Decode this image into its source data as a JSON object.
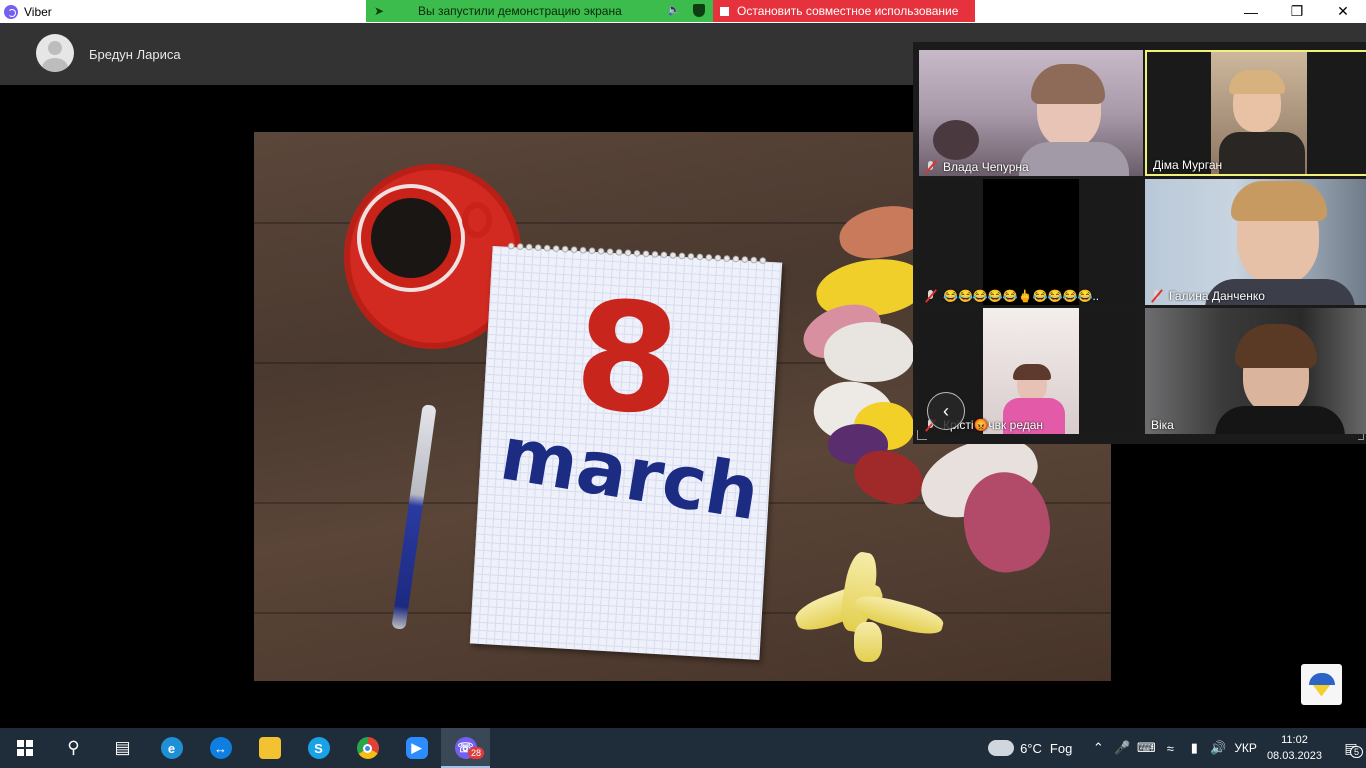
{
  "window": {
    "title": "Viber"
  },
  "share_banner": {
    "status_text": "Вы запустили демонстрацию экрана",
    "stop_text": "Остановить совместное использование",
    "colors": {
      "green": "#3cbc4c",
      "red": "#e5323c"
    }
  },
  "caller": {
    "name": "Бредун Лариса"
  },
  "shared_screen": {
    "big_number": "8",
    "word": "march"
  },
  "participants": [
    {
      "name": "Влада Чепурна",
      "muted": true
    },
    {
      "name": "Діма Мурган",
      "muted": false,
      "active": true
    },
    {
      "name": "😂😂😂😂😂🖕😂😂😂😂..",
      "muted": true
    },
    {
      "name": "Галина Данченко",
      "muted": true
    },
    {
      "name": "Крісті😡чвк редан",
      "muted": true
    },
    {
      "name": "Віка",
      "muted": false
    }
  ],
  "taskbar": {
    "apps": [
      "start",
      "search",
      "task-view",
      "edge",
      "teamviewer",
      "file-explorer",
      "skype",
      "chrome",
      "zoom",
      "viber"
    ],
    "viber_badge": "28",
    "weather": {
      "temp": "6°C",
      "condition": "Fog"
    },
    "language": "УКР",
    "time": "11:02",
    "date": "08.03.2023",
    "notifications": "5"
  }
}
